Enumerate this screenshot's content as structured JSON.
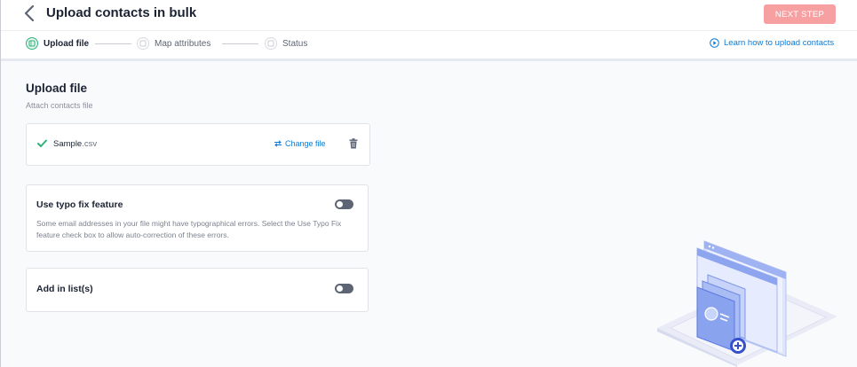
{
  "header": {
    "title": "Upload contacts in bulk",
    "next_button": "NEXT STEP",
    "colors": {
      "next_button_bg": "#f6a0a2",
      "active_step": "#2fb37c",
      "link": "#0b7bd6"
    }
  },
  "steps": [
    {
      "label": "Upload file",
      "active": true
    },
    {
      "label": "Map attributes",
      "active": false
    },
    {
      "label": "Status",
      "active": false
    }
  ],
  "learn_link": "Learn how to upload contacts",
  "main": {
    "title": "Upload file",
    "subtitle": "Attach contacts file",
    "file": {
      "name": "Sample",
      "extension": ".csv",
      "change_label": "Change file"
    },
    "typo_fix": {
      "title": "Use typo fix feature",
      "description": "Some email addresses in your file might have typographical errors. Select the Use Typo Fix feature check box to allow auto-correction of these errors.",
      "enabled": false
    },
    "add_in_list": {
      "title": "Add in list(s)",
      "enabled": false
    }
  },
  "icons": [
    "chevron-left-icon",
    "step-icon",
    "play-circle-icon",
    "check-icon",
    "swap-icon",
    "trash-icon"
  ]
}
